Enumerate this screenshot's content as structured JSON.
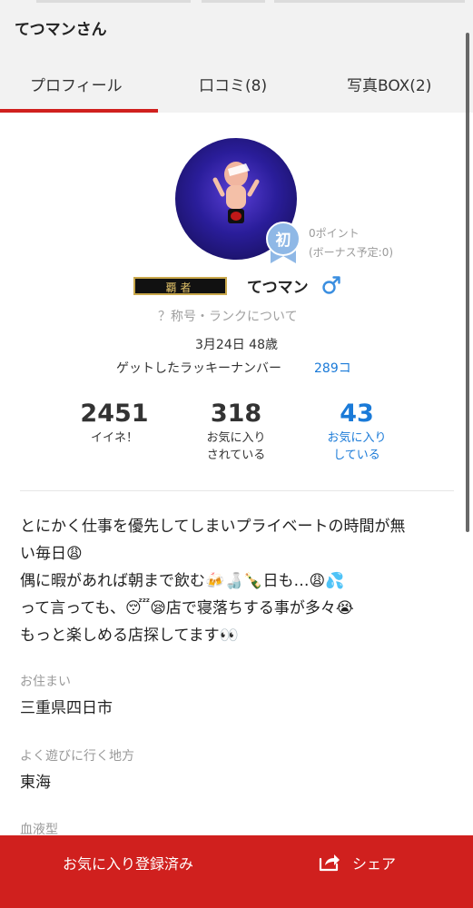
{
  "header": {
    "title": "てつマンさん"
  },
  "tabs": [
    {
      "label": "プロフィール",
      "active": true
    },
    {
      "label": "口コミ(8)"
    },
    {
      "label": "写真BOX(2)"
    }
  ],
  "profile": {
    "beginner_badge": "初",
    "points": "0ポイント",
    "bonus": "(ボーナス予定:0)",
    "rank_plate": "覇者",
    "name": "てつマン",
    "gender_icon": "male-icon",
    "rank_link": "？称号・ランクについて",
    "birthday_age": "3月24日 48歳",
    "lucky_label": "ゲットしたラッキーナンバー",
    "lucky_value": "289コ"
  },
  "stats": {
    "likes": {
      "value": "2451",
      "label": "イイネ！"
    },
    "favorited_by": {
      "value": "318",
      "label1": "お気に入り",
      "label2": "されている"
    },
    "favoriting": {
      "value": "43",
      "label1": "お気に入り",
      "label2": "している"
    }
  },
  "bio": {
    "line1": "とにかく仕事を優先してしまいプライベートの時間が無",
    "line2": "い毎日😩",
    "line3": "偶に暇があれば朝まで飲む🍻🍶🍾日も…😩💦",
    "line4": "って言っても、😴😪店で寝落ちする事が多々😭",
    "line5": "もっと楽しめる店探してます👀"
  },
  "fields": {
    "residence_label": "お住まい",
    "residence_value": "三重県四日市",
    "area_label": "よく遊びに行く地方",
    "area_value": "東海",
    "blood_label": "血液型"
  },
  "footer": {
    "favorite_label": "お気に入り登録済み",
    "share_label": "シェア"
  },
  "colors": {
    "accent": "#d0201e",
    "link": "#1a7ad8"
  }
}
